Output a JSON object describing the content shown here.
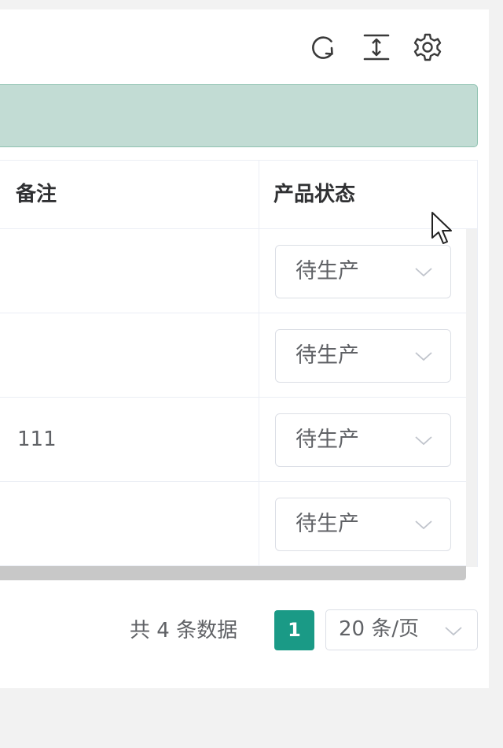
{
  "toolbar": {
    "icons": [
      "refresh-icon",
      "column-height-icon",
      "settings-icon"
    ]
  },
  "table": {
    "columns": [
      "备注",
      "产品状态"
    ],
    "rows": [
      {
        "remark": "",
        "status": "待生产"
      },
      {
        "remark": "",
        "status": "待生产"
      },
      {
        "remark": "111",
        "status": "待生产"
      },
      {
        "remark": "",
        "status": "待生产"
      }
    ]
  },
  "pagination": {
    "total": "共 4 条数据",
    "current_page": "1",
    "page_size": "20 条/页"
  },
  "colors": {
    "accent": "#1a9a86",
    "alert_bg": "#c2dcd4",
    "alert_border": "#8fc2b1"
  }
}
